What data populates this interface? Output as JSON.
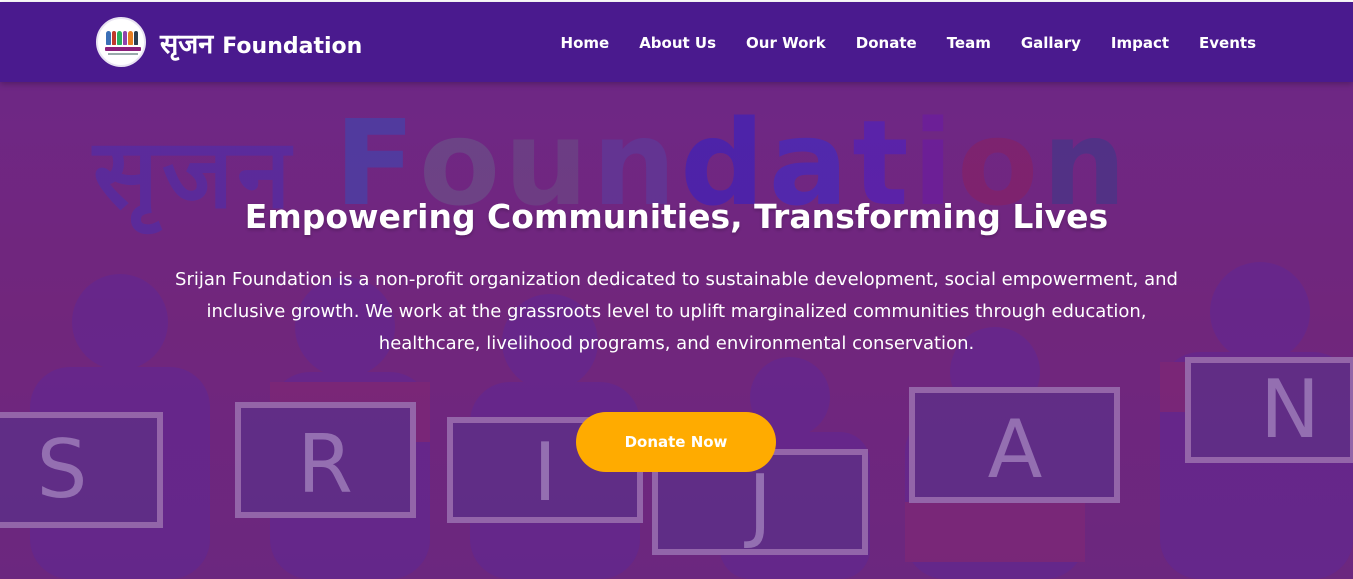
{
  "brand": {
    "name_hindi": "सृजन",
    "name_en": "Foundation"
  },
  "nav": {
    "items": [
      {
        "label": "Home"
      },
      {
        "label": "About Us"
      },
      {
        "label": "Our Work"
      },
      {
        "label": "Donate"
      },
      {
        "label": "Team"
      },
      {
        "label": "Gallary"
      },
      {
        "label": "Impact"
      },
      {
        "label": "Events"
      }
    ]
  },
  "hero": {
    "watermark_hindi": "सृजन",
    "watermark_en": "Foundation",
    "board_letters": [
      "S",
      "R",
      "I",
      "J",
      "A",
      "N"
    ],
    "title": "Empowering Communities, Transforming Lives",
    "description": "Srijan Foundation is a non-profit organization dedicated to sustainable development, social empowerment, and inclusive growth. We work at the grassroots level to uplift marginalized communities through education, healthcare, livelihood programs, and environmental conservation.",
    "cta_label": "Donate Now"
  },
  "colors": {
    "navbar": "#4a1a8e",
    "hero_tint": "#6e2a86",
    "cta": "#ffab00",
    "text": "#ffffff"
  }
}
